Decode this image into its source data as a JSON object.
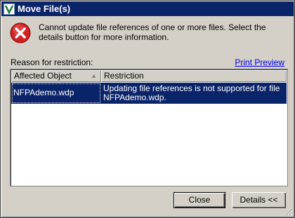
{
  "window": {
    "title": "Move File(s)"
  },
  "message": {
    "text": "Cannot update file references of one or more files. Select the details button for more information."
  },
  "reason_label": "Reason for restriction:",
  "print_preview_label": "Print Preview",
  "table": {
    "columns": [
      "Affected Object",
      "Restriction"
    ],
    "rows": [
      {
        "object": "NFPAdemo.wdp",
        "restriction": "Updating file references is not supported for file NFPAdemo.wdp."
      }
    ]
  },
  "buttons": {
    "close": "Close",
    "details": "Details <<"
  },
  "colors": {
    "titlebar": "#0a246a",
    "selection": "#0a246a",
    "error_red": "#d32020",
    "link": "#0000ee"
  },
  "icons": {
    "app": "app-logo-icon",
    "message": "error-icon",
    "sort": "sort-ascending-icon",
    "grip": "resize-grip-icon"
  }
}
